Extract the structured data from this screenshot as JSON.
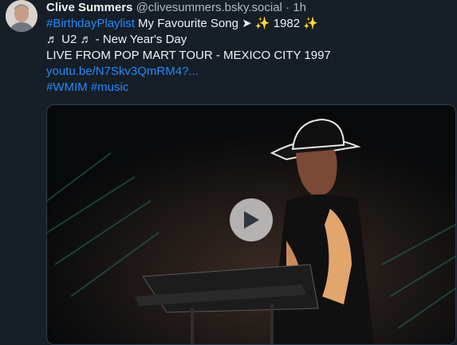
{
  "post": {
    "author_name": "Clive Summers",
    "handle": "@clivesummers.bsky.social",
    "separator": "·",
    "time": "1h",
    "hashtag_birthday": "#BirthdayPlaylist",
    "line1_rest": " My Favourite Song ➤ ✨ 1982 ✨",
    "line2": "♬ U2 ♬ - New Year's Day",
    "line3": "LIVE FROM POP MART TOUR - MEXICO CITY 1997",
    "link": "youtu.be/N7Skv3QmRM4?...",
    "hashtag_wmim": "#WMIM",
    "hashtag_music": "#music"
  },
  "colors": {
    "background": "#161e27",
    "link": "#208bfe",
    "muted": "#aebbc9"
  },
  "icons": {
    "avatar": "avatar-photo",
    "play": "play-icon"
  }
}
